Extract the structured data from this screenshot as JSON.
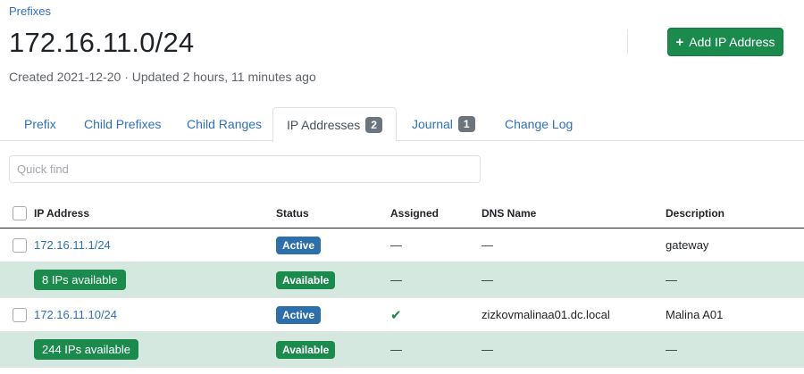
{
  "breadcrumb": "Prefixes",
  "title": "172.16.11.0/24",
  "meta": "Created 2021-12-20 · Updated 2 hours, 11 minutes ago",
  "add_button": {
    "icon": "plus-icon",
    "label": "Add IP Address"
  },
  "tabs": [
    {
      "label": "Prefix"
    },
    {
      "label": "Child Prefixes"
    },
    {
      "label": "Child Ranges"
    },
    {
      "label": "IP Addresses",
      "badge": "2",
      "active": true
    },
    {
      "label": "Journal",
      "badge": "1"
    },
    {
      "label": "Change Log"
    }
  ],
  "quick_find": {
    "placeholder": "Quick find",
    "value": ""
  },
  "table": {
    "headers": {
      "ip": "IP Address",
      "status": "Status",
      "assigned": "Assigned",
      "dns": "DNS Name",
      "description": "Description"
    },
    "rows": [
      {
        "ip": "172.16.11.1/24",
        "status": "Active",
        "assigned": "—",
        "dns": "—",
        "description": "gateway"
      },
      {
        "available": "8 IPs available",
        "status": "Available",
        "assigned": "—",
        "dns": "—",
        "description": "—"
      },
      {
        "ip": "172.16.11.10/24",
        "status": "Active",
        "assigned": "✔",
        "dns": "zizkovmalinaa01.dc.local",
        "description": "Malina A01"
      },
      {
        "available": "244 IPs available",
        "status": "Available",
        "assigned": "—",
        "dns": "—",
        "description": "—"
      }
    ]
  },
  "colors": {
    "link": "#2f6fbf",
    "success": "#1b8a4d",
    "active_status": "#2d6fab",
    "available_row": "#d4e8df",
    "badge": "#6c757d"
  }
}
